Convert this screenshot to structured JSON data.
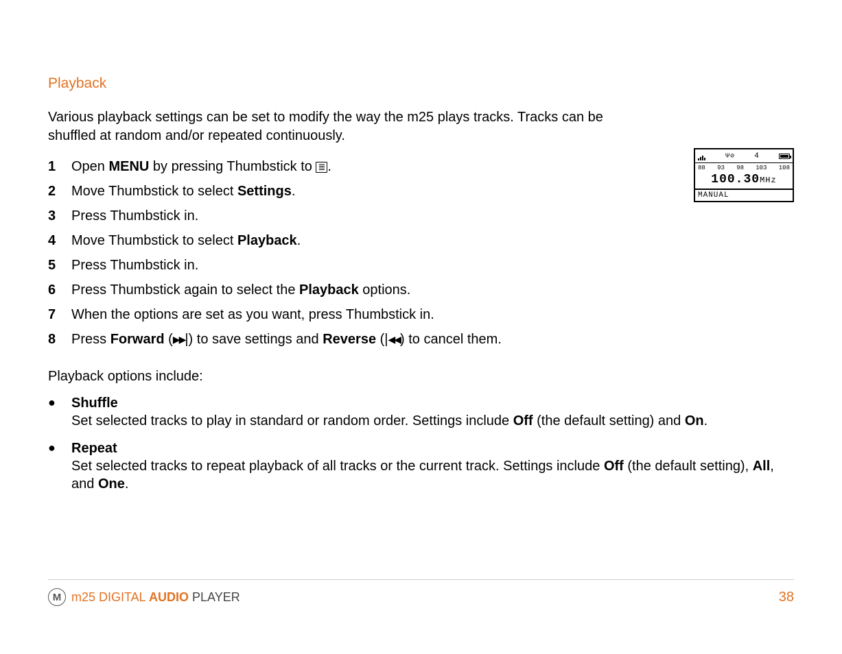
{
  "heading": "Playback",
  "intro": "Various playback settings can be set to modify the way the m25 plays tracks. Tracks can be shuffled at random and/or repeated continuously.",
  "steps": [
    {
      "n": "1",
      "html": "Open <b>MENU</b> by pressing Thumbstick to <span class='glyph-box'>≣</span>."
    },
    {
      "n": "2",
      "html": "Move Thumbstick to select <b>Settings</b>."
    },
    {
      "n": "3",
      "html": "Press Thumbstick in."
    },
    {
      "n": "4",
      "html": "Move Thumbstick to select <b>Playback</b>."
    },
    {
      "n": "5",
      "html": "Press Thumbstick in."
    },
    {
      "n": "6",
      "html": "Press Thumbstick again to select the <b>Playback</b> options."
    },
    {
      "n": "7",
      "html": "When the options are set as you want, press Thumbstick in."
    },
    {
      "n": "8",
      "html": "Press <b>Forward</b> (<span class='tri-r'>▶▶</span>|) to save settings and <b>Reverse</b> (|<span class='tri-l'>◀◀</span>) to cancel them."
    }
  ],
  "options_intro": "Playback options include:",
  "options": [
    {
      "title": "Shuffle",
      "desc": "Set selected tracks to play in standard or random order. Settings include <b>Off</b> (the default setting) and <b>On</b>."
    },
    {
      "title": "Repeat",
      "desc": "Set selected tracks to repeat playback of all tracks or the current track. Settings include <b>Off</b> (the default setting), <b>All</b>, and <b>One</b>."
    }
  ],
  "device": {
    "scale": [
      "88",
      "93",
      "98",
      "103",
      "108"
    ],
    "freq_value": "100.30",
    "freq_unit": "MHz",
    "mode": "MANUAL",
    "top_icons": {
      "signal": "...ıl.",
      "disc": "⌽⊘",
      "vol": "4"
    }
  },
  "footer": {
    "brand_prefix": "m25 DIGITAL ",
    "brand_bold": "AUDIO",
    "brand_suffix": " PLAYER",
    "page": "38",
    "logo_letter": "M"
  }
}
